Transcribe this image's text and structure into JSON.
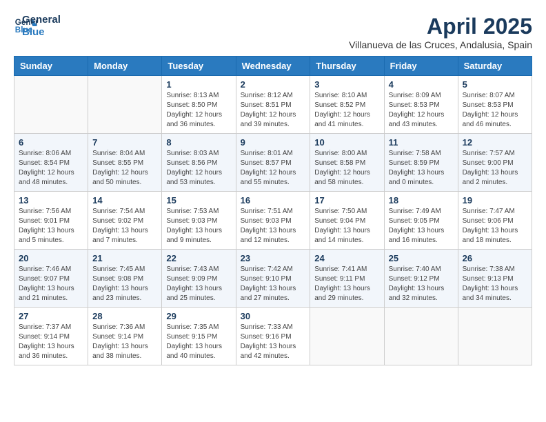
{
  "logo": {
    "line1": "General",
    "line2": "Blue"
  },
  "title": "April 2025",
  "location": "Villanueva de las Cruces, Andalusia, Spain",
  "weekdays": [
    "Sunday",
    "Monday",
    "Tuesday",
    "Wednesday",
    "Thursday",
    "Friday",
    "Saturday"
  ],
  "weeks": [
    [
      {
        "day": "",
        "sunrise": "",
        "sunset": "",
        "daylight": ""
      },
      {
        "day": "",
        "sunrise": "",
        "sunset": "",
        "daylight": ""
      },
      {
        "day": "1",
        "sunrise": "Sunrise: 8:13 AM",
        "sunset": "Sunset: 8:50 PM",
        "daylight": "Daylight: 12 hours and 36 minutes."
      },
      {
        "day": "2",
        "sunrise": "Sunrise: 8:12 AM",
        "sunset": "Sunset: 8:51 PM",
        "daylight": "Daylight: 12 hours and 39 minutes."
      },
      {
        "day": "3",
        "sunrise": "Sunrise: 8:10 AM",
        "sunset": "Sunset: 8:52 PM",
        "daylight": "Daylight: 12 hours and 41 minutes."
      },
      {
        "day": "4",
        "sunrise": "Sunrise: 8:09 AM",
        "sunset": "Sunset: 8:53 PM",
        "daylight": "Daylight: 12 hours and 43 minutes."
      },
      {
        "day": "5",
        "sunrise": "Sunrise: 8:07 AM",
        "sunset": "Sunset: 8:53 PM",
        "daylight": "Daylight: 12 hours and 46 minutes."
      }
    ],
    [
      {
        "day": "6",
        "sunrise": "Sunrise: 8:06 AM",
        "sunset": "Sunset: 8:54 PM",
        "daylight": "Daylight: 12 hours and 48 minutes."
      },
      {
        "day": "7",
        "sunrise": "Sunrise: 8:04 AM",
        "sunset": "Sunset: 8:55 PM",
        "daylight": "Daylight: 12 hours and 50 minutes."
      },
      {
        "day": "8",
        "sunrise": "Sunrise: 8:03 AM",
        "sunset": "Sunset: 8:56 PM",
        "daylight": "Daylight: 12 hours and 53 minutes."
      },
      {
        "day": "9",
        "sunrise": "Sunrise: 8:01 AM",
        "sunset": "Sunset: 8:57 PM",
        "daylight": "Daylight: 12 hours and 55 minutes."
      },
      {
        "day": "10",
        "sunrise": "Sunrise: 8:00 AM",
        "sunset": "Sunset: 8:58 PM",
        "daylight": "Daylight: 12 hours and 58 minutes."
      },
      {
        "day": "11",
        "sunrise": "Sunrise: 7:58 AM",
        "sunset": "Sunset: 8:59 PM",
        "daylight": "Daylight: 13 hours and 0 minutes."
      },
      {
        "day": "12",
        "sunrise": "Sunrise: 7:57 AM",
        "sunset": "Sunset: 9:00 PM",
        "daylight": "Daylight: 13 hours and 2 minutes."
      }
    ],
    [
      {
        "day": "13",
        "sunrise": "Sunrise: 7:56 AM",
        "sunset": "Sunset: 9:01 PM",
        "daylight": "Daylight: 13 hours and 5 minutes."
      },
      {
        "day": "14",
        "sunrise": "Sunrise: 7:54 AM",
        "sunset": "Sunset: 9:02 PM",
        "daylight": "Daylight: 13 hours and 7 minutes."
      },
      {
        "day": "15",
        "sunrise": "Sunrise: 7:53 AM",
        "sunset": "Sunset: 9:03 PM",
        "daylight": "Daylight: 13 hours and 9 minutes."
      },
      {
        "day": "16",
        "sunrise": "Sunrise: 7:51 AM",
        "sunset": "Sunset: 9:03 PM",
        "daylight": "Daylight: 13 hours and 12 minutes."
      },
      {
        "day": "17",
        "sunrise": "Sunrise: 7:50 AM",
        "sunset": "Sunset: 9:04 PM",
        "daylight": "Daylight: 13 hours and 14 minutes."
      },
      {
        "day": "18",
        "sunrise": "Sunrise: 7:49 AM",
        "sunset": "Sunset: 9:05 PM",
        "daylight": "Daylight: 13 hours and 16 minutes."
      },
      {
        "day": "19",
        "sunrise": "Sunrise: 7:47 AM",
        "sunset": "Sunset: 9:06 PM",
        "daylight": "Daylight: 13 hours and 18 minutes."
      }
    ],
    [
      {
        "day": "20",
        "sunrise": "Sunrise: 7:46 AM",
        "sunset": "Sunset: 9:07 PM",
        "daylight": "Daylight: 13 hours and 21 minutes."
      },
      {
        "day": "21",
        "sunrise": "Sunrise: 7:45 AM",
        "sunset": "Sunset: 9:08 PM",
        "daylight": "Daylight: 13 hours and 23 minutes."
      },
      {
        "day": "22",
        "sunrise": "Sunrise: 7:43 AM",
        "sunset": "Sunset: 9:09 PM",
        "daylight": "Daylight: 13 hours and 25 minutes."
      },
      {
        "day": "23",
        "sunrise": "Sunrise: 7:42 AM",
        "sunset": "Sunset: 9:10 PM",
        "daylight": "Daylight: 13 hours and 27 minutes."
      },
      {
        "day": "24",
        "sunrise": "Sunrise: 7:41 AM",
        "sunset": "Sunset: 9:11 PM",
        "daylight": "Daylight: 13 hours and 29 minutes."
      },
      {
        "day": "25",
        "sunrise": "Sunrise: 7:40 AM",
        "sunset": "Sunset: 9:12 PM",
        "daylight": "Daylight: 13 hours and 32 minutes."
      },
      {
        "day": "26",
        "sunrise": "Sunrise: 7:38 AM",
        "sunset": "Sunset: 9:13 PM",
        "daylight": "Daylight: 13 hours and 34 minutes."
      }
    ],
    [
      {
        "day": "27",
        "sunrise": "Sunrise: 7:37 AM",
        "sunset": "Sunset: 9:14 PM",
        "daylight": "Daylight: 13 hours and 36 minutes."
      },
      {
        "day": "28",
        "sunrise": "Sunrise: 7:36 AM",
        "sunset": "Sunset: 9:14 PM",
        "daylight": "Daylight: 13 hours and 38 minutes."
      },
      {
        "day": "29",
        "sunrise": "Sunrise: 7:35 AM",
        "sunset": "Sunset: 9:15 PM",
        "daylight": "Daylight: 13 hours and 40 minutes."
      },
      {
        "day": "30",
        "sunrise": "Sunrise: 7:33 AM",
        "sunset": "Sunset: 9:16 PM",
        "daylight": "Daylight: 13 hours and 42 minutes."
      },
      {
        "day": "",
        "sunrise": "",
        "sunset": "",
        "daylight": ""
      },
      {
        "day": "",
        "sunrise": "",
        "sunset": "",
        "daylight": ""
      },
      {
        "day": "",
        "sunrise": "",
        "sunset": "",
        "daylight": ""
      }
    ]
  ]
}
